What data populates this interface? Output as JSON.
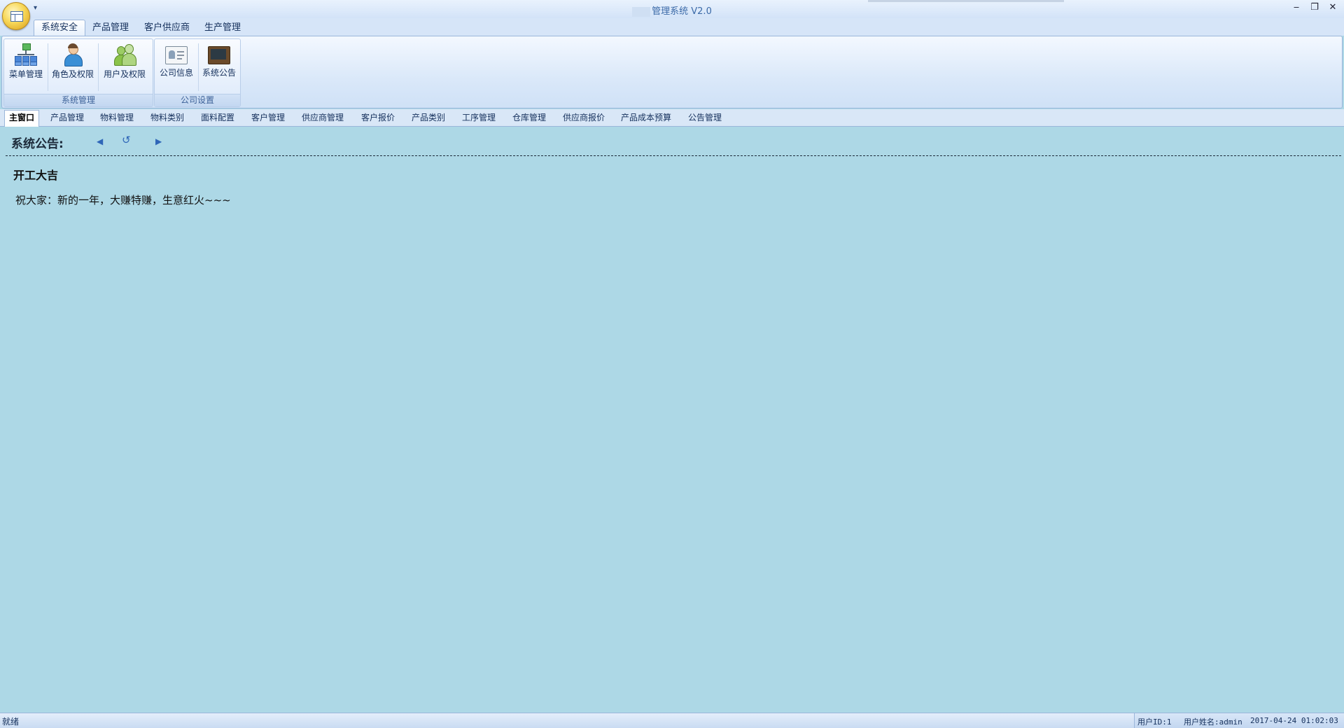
{
  "window": {
    "title": "管理系统 V2.0",
    "controls": [
      "‒",
      "❐",
      "✕"
    ]
  },
  "ribbon_tabs": [
    "系统安全",
    "产品管理",
    "客户供应商",
    "生产管理"
  ],
  "ribbon": {
    "groups": [
      {
        "label": "系统管理",
        "buttons": [
          "菜单管理",
          "角色及权限",
          "用户及权限"
        ]
      },
      {
        "label": "公司设置",
        "buttons": [
          "公司信息",
          "系统公告"
        ]
      }
    ]
  },
  "doc_tabs": [
    "主窗口",
    "产品管理",
    "物料管理",
    "物料类别",
    "面料配置",
    "客户管理",
    "供应商管理",
    "客户报价",
    "产品类别",
    "工序管理",
    "仓库管理",
    "供应商报价",
    "产品成本预算",
    "公告管理"
  ],
  "notice": {
    "heading": "系统公告:",
    "title": "开工大吉",
    "body": "祝大家：新的一年，大赚特赚，生意红火~~~"
  },
  "statusbar": {
    "left": "就绪",
    "user_id": "用户ID:1",
    "user_name": "用户姓名:admin",
    "datetime": "2017-04-24 01:02:03"
  }
}
